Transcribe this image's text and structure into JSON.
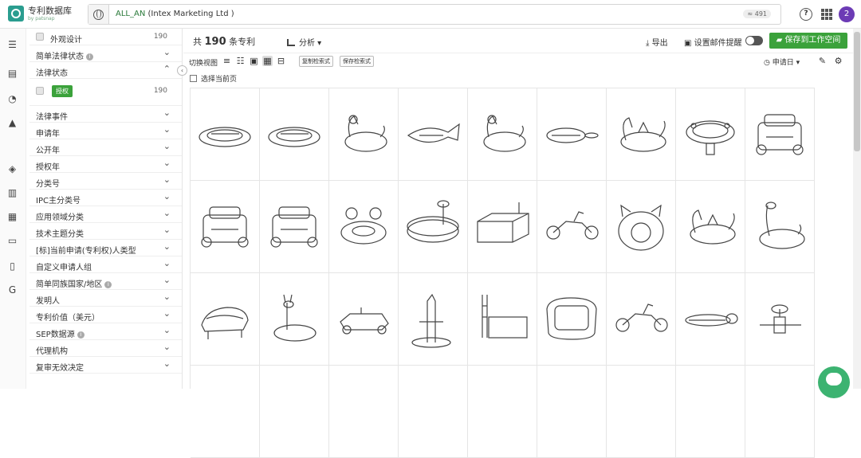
{
  "header": {
    "logo_title": "专利数据库",
    "logo_sub": "by patsnap",
    "search_field": "ALL_AN",
    "search_value": "(Intex Marketing Ltd )",
    "result_badge": "≈ 491",
    "help": "?",
    "avatar": "2"
  },
  "sidebar": {
    "items": [
      {
        "label": "外观设计",
        "count": "190",
        "type": "check"
      },
      {
        "label": "简单法律状态",
        "info": true,
        "type": "group"
      },
      {
        "label": "法律状态",
        "type": "group-open"
      },
      {
        "label": "授权",
        "count": "190",
        "type": "badge"
      },
      {
        "label": "法律事件",
        "type": "group"
      },
      {
        "label": "申请年",
        "type": "group"
      },
      {
        "label": "公开年",
        "type": "group"
      },
      {
        "label": "授权年",
        "type": "group"
      },
      {
        "label": "分类号",
        "type": "group"
      },
      {
        "label": "IPC主分类号",
        "type": "group"
      },
      {
        "label": "应用领域分类",
        "type": "group"
      },
      {
        "label": "技术主题分类",
        "type": "group"
      },
      {
        "label": "[标]当前申请(专利权)人类型",
        "type": "group"
      },
      {
        "label": "自定义申请人组",
        "type": "group"
      },
      {
        "label": "简单同族国家/地区",
        "info": true,
        "type": "group"
      },
      {
        "label": "发明人",
        "type": "group"
      },
      {
        "label": "专利价值（美元）",
        "type": "group"
      },
      {
        "label": "SEP数据源",
        "info": true,
        "type": "group"
      },
      {
        "label": "代理机构",
        "type": "group"
      },
      {
        "label": "复审无效决定",
        "type": "group"
      }
    ]
  },
  "main": {
    "results_prefix": "共",
    "results_count": "190",
    "results_suffix": "条专利",
    "analyze": "分析",
    "export": "导出",
    "email_alert": "设置邮件提醒",
    "save_workspace": "保存到工作空间",
    "switch_view": "切换视图",
    "copy_query": "复制检索式",
    "save_query": "保存检索式",
    "sort": "申请日",
    "select_page": "选择当前页"
  },
  "thumbnails": [
    "boat-float",
    "boat-float",
    "unicorn-float",
    "fish-float",
    "unicorn-float",
    "whale-float",
    "dragon-float",
    "spa-tub",
    "pool-robot",
    "pool-robot",
    "pool-robot",
    "crab-float",
    "round-pool",
    "rect-pool",
    "motorbike-float",
    "bear-pool",
    "dragon-float",
    "giraffe-float",
    "lounger",
    "llama-float",
    "kart-float",
    "giraffe-sprinkler",
    "ladder-pool",
    "oval-pool",
    "motorbike-float",
    "board-float",
    "spray-arch"
  ]
}
